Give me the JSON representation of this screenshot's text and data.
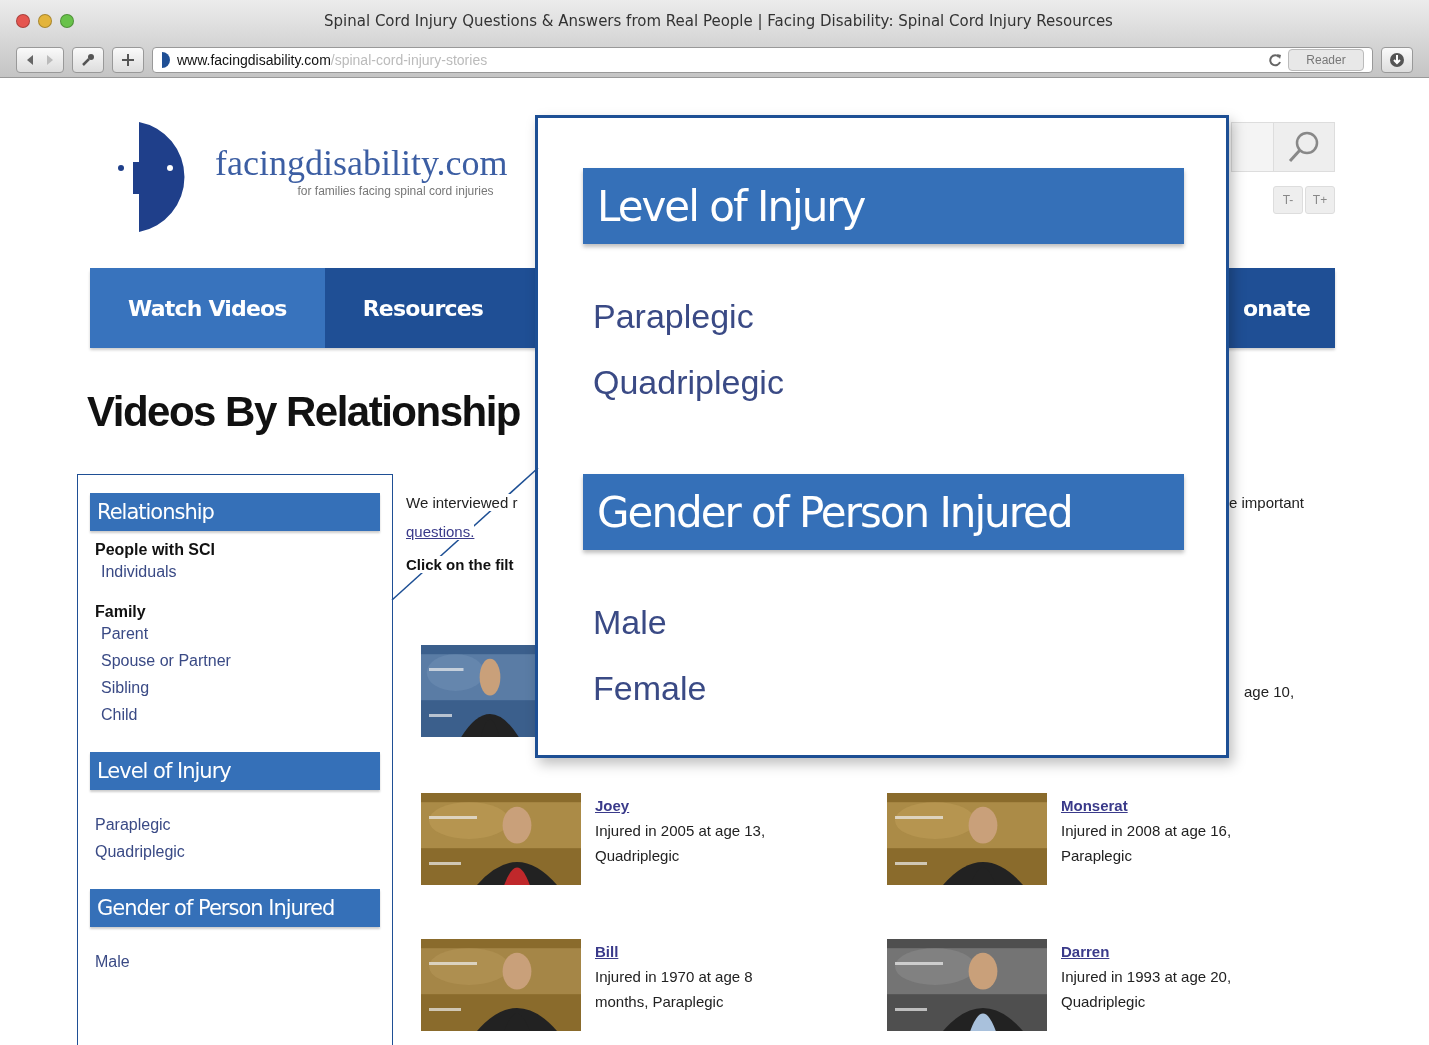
{
  "window": {
    "title": "Spinal Cord Injury Questions & Answers from Real People | Facing Disability: Spinal Cord Injury Resources"
  },
  "toolbar": {
    "url_domain": "www.facingdisability.com",
    "url_path": "/spinal-cord-injury-stories",
    "reader": "Reader"
  },
  "site": {
    "logo": "facingdisability.com",
    "tagline": "for families facing spinal cord injuries",
    "text_size_buttons": [
      "T-",
      "T+"
    ]
  },
  "nav": [
    {
      "label": "Watch Videos",
      "selected": true
    },
    {
      "label": "Resources",
      "selected": false
    },
    {
      "label": "onate",
      "selected": false
    }
  ],
  "heading": "Videos By Relationship",
  "sidebar": {
    "sections": [
      {
        "title": "Relationship",
        "groups": [
          {
            "label": "People with SCI",
            "items": [
              "Individuals"
            ]
          },
          {
            "label": "Family",
            "items": [
              "Parent",
              "Spouse or Partner",
              "Sibling",
              "Child"
            ]
          }
        ]
      },
      {
        "title": "Level of Injury",
        "groups": [
          {
            "items": [
              "Paraplegic",
              "Quadriplegic"
            ]
          }
        ]
      },
      {
        "title": "Gender of Person Injured",
        "groups": [
          {
            "items": [
              "Male"
            ]
          }
        ]
      }
    ]
  },
  "intro": {
    "line_1": "We interviewed r",
    "link": "questions.",
    "instruction": "Click on the filt",
    "right_fragment": "e important"
  },
  "first_video": {
    "caption_fragment": "age 10,"
  },
  "videos": [
    {
      "name": "Joey",
      "details": "Injured in 2005 at age 13, Quadriplegic"
    },
    {
      "name": "Monserat",
      "details": "Injured in 2008 at age 16, Paraplegic"
    },
    {
      "name": "Bill",
      "details": "Injured in 1970 at age 8 months, Paraplegic"
    },
    {
      "name": "Darren",
      "details": "Injured in 1993 at age 20, Quadriplegic"
    }
  ],
  "callout": {
    "sections": [
      {
        "title": "Level of Injury",
        "items": [
          "Paraplegic",
          "Quadriplegic"
        ]
      },
      {
        "title": "Gender of Person Injured",
        "items": [
          "Male",
          "Female"
        ]
      }
    ]
  }
}
